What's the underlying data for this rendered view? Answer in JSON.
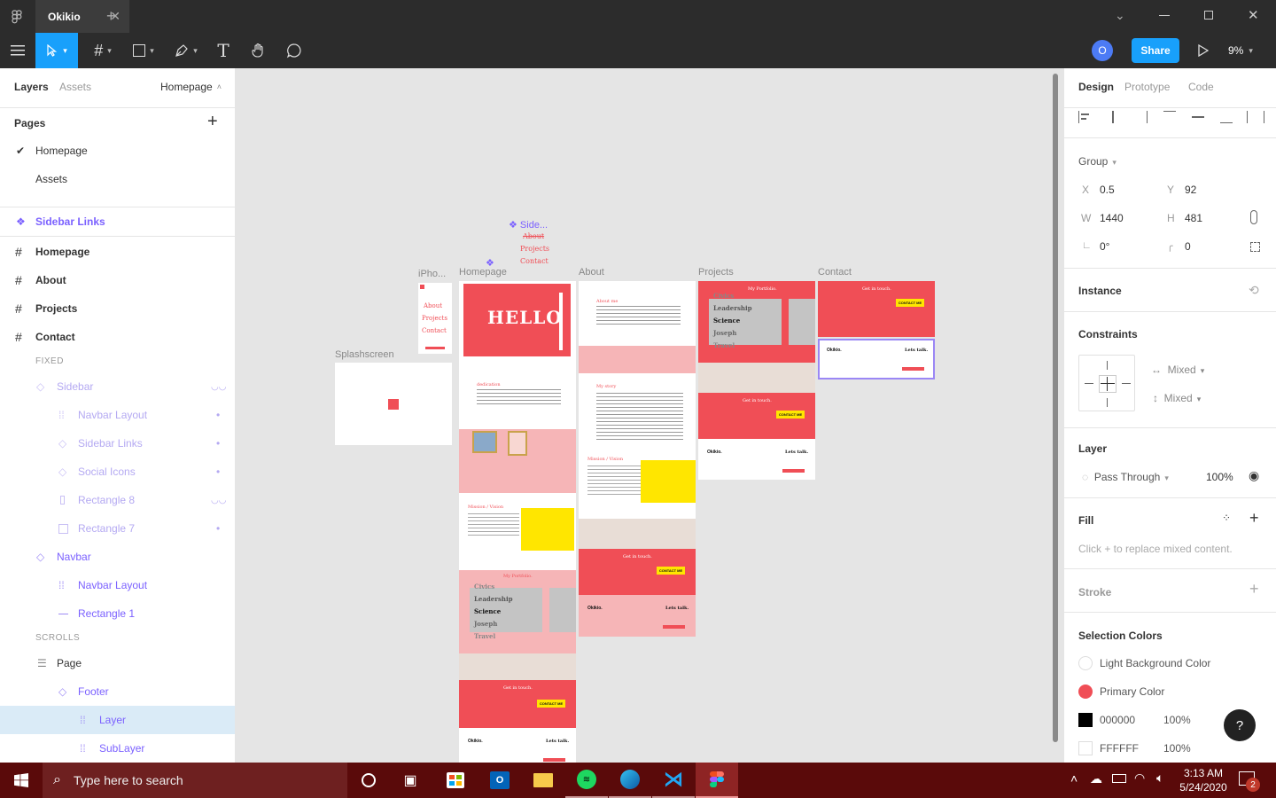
{
  "app": {
    "tab_title": "Okikio"
  },
  "toolbar": {
    "avatar_letter": "O",
    "share_label": "Share",
    "zoom": "9%"
  },
  "left": {
    "tabs": {
      "layers": "Layers",
      "assets": "Assets"
    },
    "page_select": "Homepage",
    "pages_title": "Pages",
    "pages": [
      "Homepage",
      "Assets"
    ],
    "layers": [
      {
        "label": "Sidebar Links"
      },
      {
        "label": "Homepage"
      },
      {
        "label": "About"
      },
      {
        "label": "Projects"
      },
      {
        "label": "Contact"
      },
      {
        "label": "FIXED"
      },
      {
        "label": "Sidebar"
      },
      {
        "label": "Navbar Layout"
      },
      {
        "label": "Sidebar Links"
      },
      {
        "label": "Social Icons"
      },
      {
        "label": "Rectangle 8"
      },
      {
        "label": "Rectangle 7"
      },
      {
        "label": "Navbar"
      },
      {
        "label": "Navbar Layout"
      },
      {
        "label": "Rectangle 1"
      },
      {
        "label": "SCROLLS"
      },
      {
        "label": "Page"
      },
      {
        "label": "Footer"
      },
      {
        "label": "Layer"
      },
      {
        "label": "SubLayer"
      }
    ]
  },
  "canvas": {
    "frame_labels": {
      "splash": "Splashscreen",
      "iphone": "iPho...",
      "homepage": "Homepage",
      "about": "About",
      "projects": "Projects",
      "contact": "Contact",
      "sidebar": "Side..."
    },
    "sidebar_links": [
      "About",
      "Projects",
      "Contact"
    ],
    "hello": "HELLO",
    "get_in_touch": "Get in touch.",
    "contact_me": "CONTACT ME",
    "lets_talk": "Lets talk.",
    "okikio": "Okikio.",
    "portfolio_title": "My Portfolio.",
    "portfolio_words": [
      "Civics",
      "Leadership",
      "Science",
      "Joseph",
      "Travel"
    ],
    "about_me": "About me",
    "my_story": "My story",
    "mission": "Mission / Vision",
    "dedication": "dedication"
  },
  "right": {
    "tabs": {
      "design": "Design",
      "prototype": "Prototype",
      "code": "Code"
    },
    "group_label": "Group",
    "x_label": "X",
    "x": "0.5",
    "y_label": "Y",
    "y": "92",
    "w_label": "W",
    "w": "1440",
    "h_label": "H",
    "h": "481",
    "rotation": "0°",
    "radius": "0",
    "instance": "Instance",
    "constraints": "Constraints",
    "mixed_h": "Mixed",
    "mixed_v": "Mixed",
    "layer": "Layer",
    "blend": "Pass Through",
    "opacity": "100%",
    "fill": "Fill",
    "fill_hint": "Click + to replace mixed content.",
    "stroke": "Stroke",
    "selection_colors": "Selection Colors",
    "colors": [
      {
        "name": "Light Background Color",
        "swatch": "#ffffff",
        "pct": ""
      },
      {
        "name": "Primary Color",
        "swatch": "#f04e56",
        "pct": ""
      },
      {
        "name": "000000",
        "swatch": "#000000",
        "pct": "100%"
      },
      {
        "name": "FFFFFF",
        "swatch": "#ffffff",
        "pct": "100%"
      }
    ],
    "help": "?"
  },
  "taskbar": {
    "search_placeholder": "Type here to search",
    "time": "3:13 AM",
    "date": "5/24/2020",
    "notif_count": "2"
  }
}
